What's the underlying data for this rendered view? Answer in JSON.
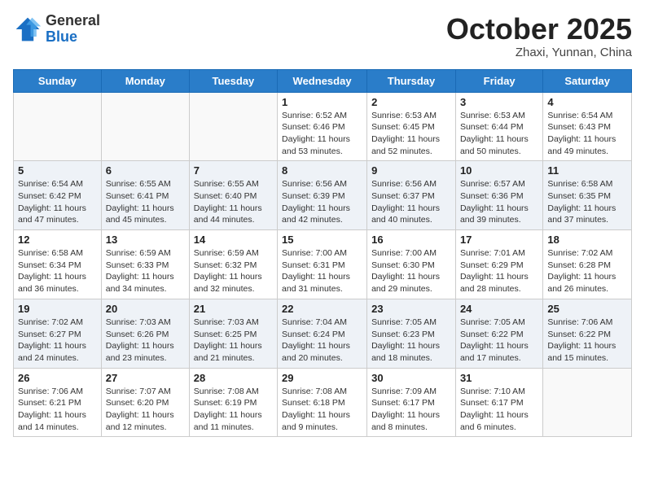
{
  "header": {
    "logo_general": "General",
    "logo_blue": "Blue",
    "month": "October 2025",
    "location": "Zhaxi, Yunnan, China"
  },
  "weekdays": [
    "Sunday",
    "Monday",
    "Tuesday",
    "Wednesday",
    "Thursday",
    "Friday",
    "Saturday"
  ],
  "weeks": [
    [
      {
        "day": "",
        "info": ""
      },
      {
        "day": "",
        "info": ""
      },
      {
        "day": "",
        "info": ""
      },
      {
        "day": "1",
        "info": "Sunrise: 6:52 AM\nSunset: 6:46 PM\nDaylight: 11 hours\nand 53 minutes."
      },
      {
        "day": "2",
        "info": "Sunrise: 6:53 AM\nSunset: 6:45 PM\nDaylight: 11 hours\nand 52 minutes."
      },
      {
        "day": "3",
        "info": "Sunrise: 6:53 AM\nSunset: 6:44 PM\nDaylight: 11 hours\nand 50 minutes."
      },
      {
        "day": "4",
        "info": "Sunrise: 6:54 AM\nSunset: 6:43 PM\nDaylight: 11 hours\nand 49 minutes."
      }
    ],
    [
      {
        "day": "5",
        "info": "Sunrise: 6:54 AM\nSunset: 6:42 PM\nDaylight: 11 hours\nand 47 minutes."
      },
      {
        "day": "6",
        "info": "Sunrise: 6:55 AM\nSunset: 6:41 PM\nDaylight: 11 hours\nand 45 minutes."
      },
      {
        "day": "7",
        "info": "Sunrise: 6:55 AM\nSunset: 6:40 PM\nDaylight: 11 hours\nand 44 minutes."
      },
      {
        "day": "8",
        "info": "Sunrise: 6:56 AM\nSunset: 6:39 PM\nDaylight: 11 hours\nand 42 minutes."
      },
      {
        "day": "9",
        "info": "Sunrise: 6:56 AM\nSunset: 6:37 PM\nDaylight: 11 hours\nand 40 minutes."
      },
      {
        "day": "10",
        "info": "Sunrise: 6:57 AM\nSunset: 6:36 PM\nDaylight: 11 hours\nand 39 minutes."
      },
      {
        "day": "11",
        "info": "Sunrise: 6:58 AM\nSunset: 6:35 PM\nDaylight: 11 hours\nand 37 minutes."
      }
    ],
    [
      {
        "day": "12",
        "info": "Sunrise: 6:58 AM\nSunset: 6:34 PM\nDaylight: 11 hours\nand 36 minutes."
      },
      {
        "day": "13",
        "info": "Sunrise: 6:59 AM\nSunset: 6:33 PM\nDaylight: 11 hours\nand 34 minutes."
      },
      {
        "day": "14",
        "info": "Sunrise: 6:59 AM\nSunset: 6:32 PM\nDaylight: 11 hours\nand 32 minutes."
      },
      {
        "day": "15",
        "info": "Sunrise: 7:00 AM\nSunset: 6:31 PM\nDaylight: 11 hours\nand 31 minutes."
      },
      {
        "day": "16",
        "info": "Sunrise: 7:00 AM\nSunset: 6:30 PM\nDaylight: 11 hours\nand 29 minutes."
      },
      {
        "day": "17",
        "info": "Sunrise: 7:01 AM\nSunset: 6:29 PM\nDaylight: 11 hours\nand 28 minutes."
      },
      {
        "day": "18",
        "info": "Sunrise: 7:02 AM\nSunset: 6:28 PM\nDaylight: 11 hours\nand 26 minutes."
      }
    ],
    [
      {
        "day": "19",
        "info": "Sunrise: 7:02 AM\nSunset: 6:27 PM\nDaylight: 11 hours\nand 24 minutes."
      },
      {
        "day": "20",
        "info": "Sunrise: 7:03 AM\nSunset: 6:26 PM\nDaylight: 11 hours\nand 23 minutes."
      },
      {
        "day": "21",
        "info": "Sunrise: 7:03 AM\nSunset: 6:25 PM\nDaylight: 11 hours\nand 21 minutes."
      },
      {
        "day": "22",
        "info": "Sunrise: 7:04 AM\nSunset: 6:24 PM\nDaylight: 11 hours\nand 20 minutes."
      },
      {
        "day": "23",
        "info": "Sunrise: 7:05 AM\nSunset: 6:23 PM\nDaylight: 11 hours\nand 18 minutes."
      },
      {
        "day": "24",
        "info": "Sunrise: 7:05 AM\nSunset: 6:22 PM\nDaylight: 11 hours\nand 17 minutes."
      },
      {
        "day": "25",
        "info": "Sunrise: 7:06 AM\nSunset: 6:22 PM\nDaylight: 11 hours\nand 15 minutes."
      }
    ],
    [
      {
        "day": "26",
        "info": "Sunrise: 7:06 AM\nSunset: 6:21 PM\nDaylight: 11 hours\nand 14 minutes."
      },
      {
        "day": "27",
        "info": "Sunrise: 7:07 AM\nSunset: 6:20 PM\nDaylight: 11 hours\nand 12 minutes."
      },
      {
        "day": "28",
        "info": "Sunrise: 7:08 AM\nSunset: 6:19 PM\nDaylight: 11 hours\nand 11 minutes."
      },
      {
        "day": "29",
        "info": "Sunrise: 7:08 AM\nSunset: 6:18 PM\nDaylight: 11 hours\nand 9 minutes."
      },
      {
        "day": "30",
        "info": "Sunrise: 7:09 AM\nSunset: 6:17 PM\nDaylight: 11 hours\nand 8 minutes."
      },
      {
        "day": "31",
        "info": "Sunrise: 7:10 AM\nSunset: 6:17 PM\nDaylight: 11 hours\nand 6 minutes."
      },
      {
        "day": "",
        "info": ""
      }
    ]
  ]
}
